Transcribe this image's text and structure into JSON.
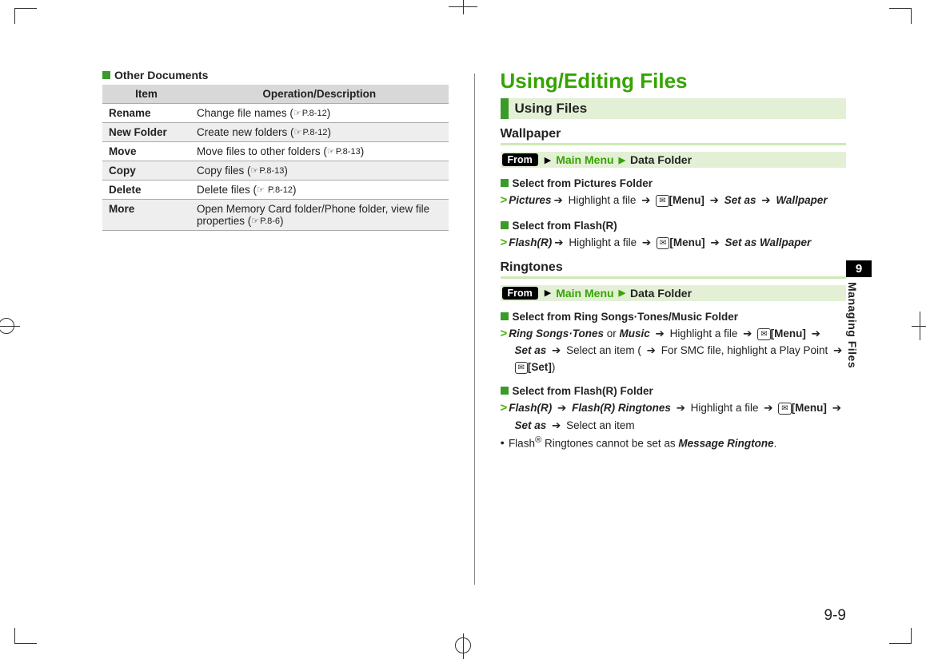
{
  "left": {
    "section_label": "Other Documents",
    "columns": [
      "Item",
      "Operation/Description"
    ],
    "rows": [
      {
        "item": "Rename",
        "desc_pre": "Change file names (",
        "ref": "P.8-12",
        "desc_post": ")"
      },
      {
        "item": "New Folder",
        "desc_pre": "Create new folders (",
        "ref": "P.8-12",
        "desc_post": ")"
      },
      {
        "item": "Move",
        "desc_pre": "Move files to other folders (",
        "ref": "P.8-13",
        "desc_post": ")"
      },
      {
        "item": "Copy",
        "desc_pre": "Copy files (",
        "ref": "P.8-13",
        "desc_post": ")"
      },
      {
        "item": "Delete",
        "desc_pre": "Delete files (",
        "ref": " P.8-12",
        "desc_post": ")"
      },
      {
        "item": "More",
        "desc_pre": "Open Memory Card folder/Phone folder, view file properties (",
        "ref": "P.8-6",
        "desc_post": ")"
      }
    ]
  },
  "right": {
    "title": "Using/Editing Files",
    "band": "Using Files",
    "wallpaper": {
      "heading": "Wallpaper",
      "from": {
        "badge": "From",
        "menu": "Main Menu",
        "dest": "Data Folder"
      },
      "b1": {
        "hd": "Select from Pictures Folder",
        "s1": "Pictures",
        "t1": " Highlight a file ",
        "m": "[Menu]",
        "s2": "Set as",
        "s3": "Wallpaper"
      },
      "b2": {
        "hd": "Select from Flash(R)",
        "s1": "Flash(R)",
        "t1": " Highlight a file ",
        "m": "[Menu]",
        "s2": "Set as Wallpaper"
      }
    },
    "ringtones": {
      "heading": "Ringtones",
      "from": {
        "badge": "From",
        "menu": "Main Menu",
        "dest": "Data Folder"
      },
      "b1": {
        "hd": "Select from Ring Songs·Tones/Music Folder",
        "s1": "Ring Songs·Tones",
        "or": " or ",
        "s1b": "Music",
        "t1": " Highlight a file ",
        "m": "[Menu]",
        "s2": "Set as",
        "t2": " Select an item ( ",
        "t3": " For SMC file, highlight a Play Point ",
        "m2": "[Set]",
        "t4": ")"
      },
      "b2": {
        "hd": "Select from Flash(R) Folder",
        "s1": "Flash(R)",
        "s1b": "Flash(R) Ringtones",
        "t1": " Highlight a file ",
        "m": "[Menu]",
        "s2": "Set as",
        "t2": " Select an item"
      },
      "note_pre": "Flash",
      "note_sup": "®",
      "note_post": " Ringtones cannot be set as ",
      "note_em": "Message Ringtone",
      "note_end": "."
    }
  },
  "side": {
    "num": "9",
    "label": "Managing Files"
  },
  "pagenum": "9-9"
}
